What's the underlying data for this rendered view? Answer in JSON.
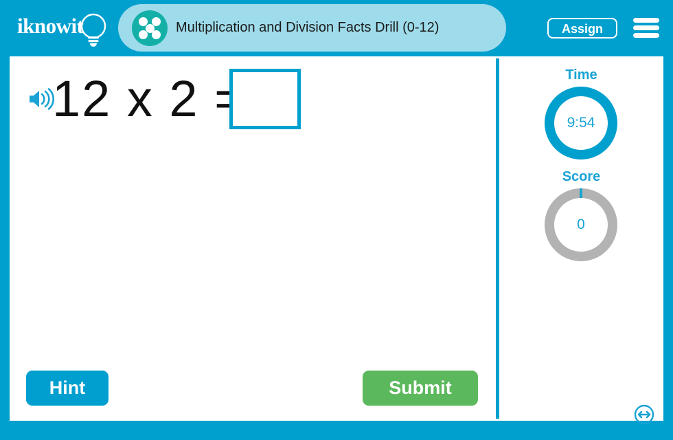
{
  "header": {
    "logo_text": "iknowit",
    "logo_icon": "lightbulb-icon",
    "activity_icon": "five-dot-circle-icon",
    "title": "Multiplication and Division Facts Drill (0-12)",
    "assign_label": "Assign",
    "menu_icon": "hamburger-menu-icon"
  },
  "problem": {
    "audio_icon": "speaker-icon",
    "expression": "12 x 2 =",
    "answer_value": "",
    "answer_placeholder": ""
  },
  "actions": {
    "hint_label": "Hint",
    "submit_label": "Submit",
    "resize_icon": "resize-horizontal-icon"
  },
  "stats": {
    "time": {
      "label": "Time",
      "value": "9:54",
      "progress_percent": 99
    },
    "score": {
      "label": "Score",
      "value": "0",
      "progress_percent": 0
    }
  },
  "colors": {
    "primary_blue": "#00a0ce",
    "light_blue": "#9fdceb",
    "teal": "#14b0a8",
    "green": "#5cb85c",
    "gray_ring": "#b3b3b3",
    "text_blue": "#1aa3d4"
  }
}
